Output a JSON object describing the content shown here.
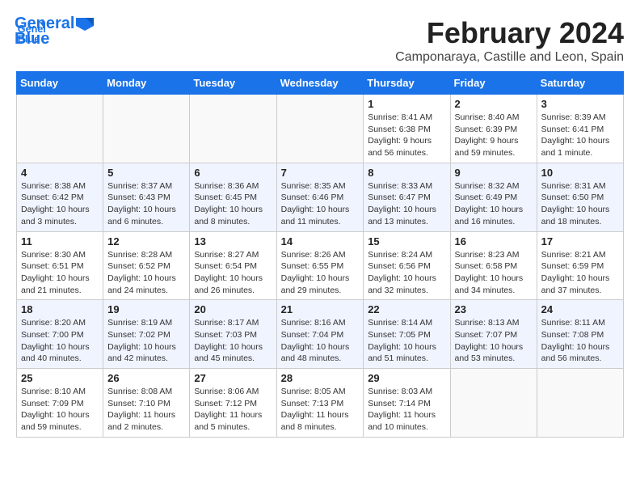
{
  "logo": {
    "text_general": "General",
    "text_blue": "Blue"
  },
  "header": {
    "month_year": "February 2024",
    "location": "Camponaraya, Castille and Leon, Spain"
  },
  "weekdays": [
    "Sunday",
    "Monday",
    "Tuesday",
    "Wednesday",
    "Thursday",
    "Friday",
    "Saturday"
  ],
  "weeks": [
    [
      {
        "day": "",
        "info": ""
      },
      {
        "day": "",
        "info": ""
      },
      {
        "day": "",
        "info": ""
      },
      {
        "day": "",
        "info": ""
      },
      {
        "day": "1",
        "info": "Sunrise: 8:41 AM\nSunset: 6:38 PM\nDaylight: 9 hours and 56 minutes."
      },
      {
        "day": "2",
        "info": "Sunrise: 8:40 AM\nSunset: 6:39 PM\nDaylight: 9 hours and 59 minutes."
      },
      {
        "day": "3",
        "info": "Sunrise: 8:39 AM\nSunset: 6:41 PM\nDaylight: 10 hours and 1 minute."
      }
    ],
    [
      {
        "day": "4",
        "info": "Sunrise: 8:38 AM\nSunset: 6:42 PM\nDaylight: 10 hours and 3 minutes."
      },
      {
        "day": "5",
        "info": "Sunrise: 8:37 AM\nSunset: 6:43 PM\nDaylight: 10 hours and 6 minutes."
      },
      {
        "day": "6",
        "info": "Sunrise: 8:36 AM\nSunset: 6:45 PM\nDaylight: 10 hours and 8 minutes."
      },
      {
        "day": "7",
        "info": "Sunrise: 8:35 AM\nSunset: 6:46 PM\nDaylight: 10 hours and 11 minutes."
      },
      {
        "day": "8",
        "info": "Sunrise: 8:33 AM\nSunset: 6:47 PM\nDaylight: 10 hours and 13 minutes."
      },
      {
        "day": "9",
        "info": "Sunrise: 8:32 AM\nSunset: 6:49 PM\nDaylight: 10 hours and 16 minutes."
      },
      {
        "day": "10",
        "info": "Sunrise: 8:31 AM\nSunset: 6:50 PM\nDaylight: 10 hours and 18 minutes."
      }
    ],
    [
      {
        "day": "11",
        "info": "Sunrise: 8:30 AM\nSunset: 6:51 PM\nDaylight: 10 hours and 21 minutes."
      },
      {
        "day": "12",
        "info": "Sunrise: 8:28 AM\nSunset: 6:52 PM\nDaylight: 10 hours and 24 minutes."
      },
      {
        "day": "13",
        "info": "Sunrise: 8:27 AM\nSunset: 6:54 PM\nDaylight: 10 hours and 26 minutes."
      },
      {
        "day": "14",
        "info": "Sunrise: 8:26 AM\nSunset: 6:55 PM\nDaylight: 10 hours and 29 minutes."
      },
      {
        "day": "15",
        "info": "Sunrise: 8:24 AM\nSunset: 6:56 PM\nDaylight: 10 hours and 32 minutes."
      },
      {
        "day": "16",
        "info": "Sunrise: 8:23 AM\nSunset: 6:58 PM\nDaylight: 10 hours and 34 minutes."
      },
      {
        "day": "17",
        "info": "Sunrise: 8:21 AM\nSunset: 6:59 PM\nDaylight: 10 hours and 37 minutes."
      }
    ],
    [
      {
        "day": "18",
        "info": "Sunrise: 8:20 AM\nSunset: 7:00 PM\nDaylight: 10 hours and 40 minutes."
      },
      {
        "day": "19",
        "info": "Sunrise: 8:19 AM\nSunset: 7:02 PM\nDaylight: 10 hours and 42 minutes."
      },
      {
        "day": "20",
        "info": "Sunrise: 8:17 AM\nSunset: 7:03 PM\nDaylight: 10 hours and 45 minutes."
      },
      {
        "day": "21",
        "info": "Sunrise: 8:16 AM\nSunset: 7:04 PM\nDaylight: 10 hours and 48 minutes."
      },
      {
        "day": "22",
        "info": "Sunrise: 8:14 AM\nSunset: 7:05 PM\nDaylight: 10 hours and 51 minutes."
      },
      {
        "day": "23",
        "info": "Sunrise: 8:13 AM\nSunset: 7:07 PM\nDaylight: 10 hours and 53 minutes."
      },
      {
        "day": "24",
        "info": "Sunrise: 8:11 AM\nSunset: 7:08 PM\nDaylight: 10 hours and 56 minutes."
      }
    ],
    [
      {
        "day": "25",
        "info": "Sunrise: 8:10 AM\nSunset: 7:09 PM\nDaylight: 10 hours and 59 minutes."
      },
      {
        "day": "26",
        "info": "Sunrise: 8:08 AM\nSunset: 7:10 PM\nDaylight: 11 hours and 2 minutes."
      },
      {
        "day": "27",
        "info": "Sunrise: 8:06 AM\nSunset: 7:12 PM\nDaylight: 11 hours and 5 minutes."
      },
      {
        "day": "28",
        "info": "Sunrise: 8:05 AM\nSunset: 7:13 PM\nDaylight: 11 hours and 8 minutes."
      },
      {
        "day": "29",
        "info": "Sunrise: 8:03 AM\nSunset: 7:14 PM\nDaylight: 11 hours and 10 minutes."
      },
      {
        "day": "",
        "info": ""
      },
      {
        "day": "",
        "info": ""
      }
    ]
  ]
}
